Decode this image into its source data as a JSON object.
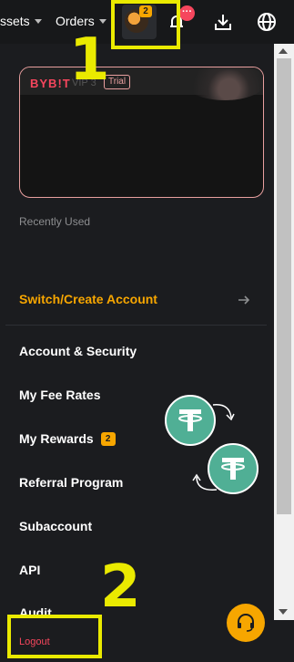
{
  "nav": {
    "assets_label": "ssets",
    "orders_label": "Orders",
    "avatar_badge": "2",
    "notif_count": "···"
  },
  "account_card": {
    "logo": "BYB!T",
    "vip": "VIP 3",
    "tag": "Trial"
  },
  "recently_used": "Recently Used",
  "switch_account": "Switch/Create Account",
  "menu": {
    "account_security": "Account & Security",
    "fee_rates": "My Fee Rates",
    "rewards": "My Rewards",
    "rewards_badge": "2",
    "referral": "Referral Program",
    "subaccount": "Subaccount",
    "api": "API",
    "audit": "Audit",
    "logout": "Logout"
  },
  "annotations": {
    "one": "1",
    "two": "2"
  },
  "colors": {
    "accent": "#f7a600",
    "danger": "#f6465d",
    "annotation": "#eaea00"
  }
}
